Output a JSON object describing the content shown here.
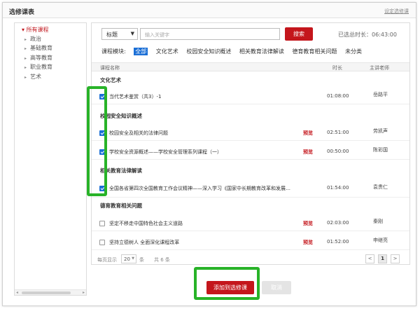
{
  "header": {
    "title": "选修课表",
    "link": "设定选修课"
  },
  "sidebar": {
    "root": "所有课程",
    "items": [
      {
        "label": "政治"
      },
      {
        "label": "基础教育"
      },
      {
        "label": "高等教育"
      },
      {
        "label": "职业教育"
      },
      {
        "label": "艺术"
      }
    ]
  },
  "search": {
    "field": "标题",
    "placeholder": "输入关键字",
    "button": "搜索",
    "selected_time": "已选总时长：06:43:00"
  },
  "modules": {
    "label": "课程模块:",
    "items": [
      "全部",
      "文化艺术",
      "校园安全知识概述",
      "相关教育法律解读",
      "德育教育相关问题",
      "未分类"
    ],
    "active_index": 0
  },
  "list_header": {
    "name": "课程名称",
    "duration": "时长",
    "teacher": "主讲老师"
  },
  "groups": [
    {
      "title": "文化艺术",
      "rows": [
        {
          "name": "当代艺术鉴赏（共3）-1",
          "preview": "",
          "duration": "01:08:00",
          "teacher": "岳路平",
          "checked": true
        }
      ]
    },
    {
      "title": "校园安全知识概述",
      "rows": [
        {
          "name": "校园安全及相关的法律问题",
          "preview": "预览",
          "duration": "02:51:00",
          "teacher": "劳凯声",
          "checked": true
        },
        {
          "name": "学校安全资源概述——学校安全管理系列课程（一）",
          "preview": "预览",
          "duration": "00:50:00",
          "teacher": "陈彩国",
          "checked": true
        }
      ]
    },
    {
      "title": "相关教育法律解读",
      "rows": [
        {
          "name": "全国各省第四次全国教育工作会议精神——深入学习《国家中长期教育改革和发展规划纲要》",
          "preview": "",
          "duration": "01:54:00",
          "teacher": "袁贵仁",
          "checked": true
        }
      ]
    },
    {
      "title": "德育教育相关问题",
      "rows": [
        {
          "name": "坚定不移走中国特色社会主义道路",
          "preview": "预览",
          "duration": "02:03:00",
          "teacher": "秦刚",
          "checked": false
        },
        {
          "name": "坚持立德树人 全面深化课程改革",
          "preview": "预览",
          "duration": "01:52:00",
          "teacher": "申继亮",
          "checked": false
        }
      ]
    }
  ],
  "pagination": {
    "per_page_label": "每页显示",
    "per_page": "20",
    "unit": "条",
    "total": "共 6 条",
    "prev": "<",
    "current": "1",
    "next": ">"
  },
  "actions": {
    "add": "添加到选修课",
    "cancel": "取消"
  },
  "colors": {
    "accent": "#c4161c",
    "active_tab": "#1b6fd6",
    "highlight": "#28b328"
  }
}
